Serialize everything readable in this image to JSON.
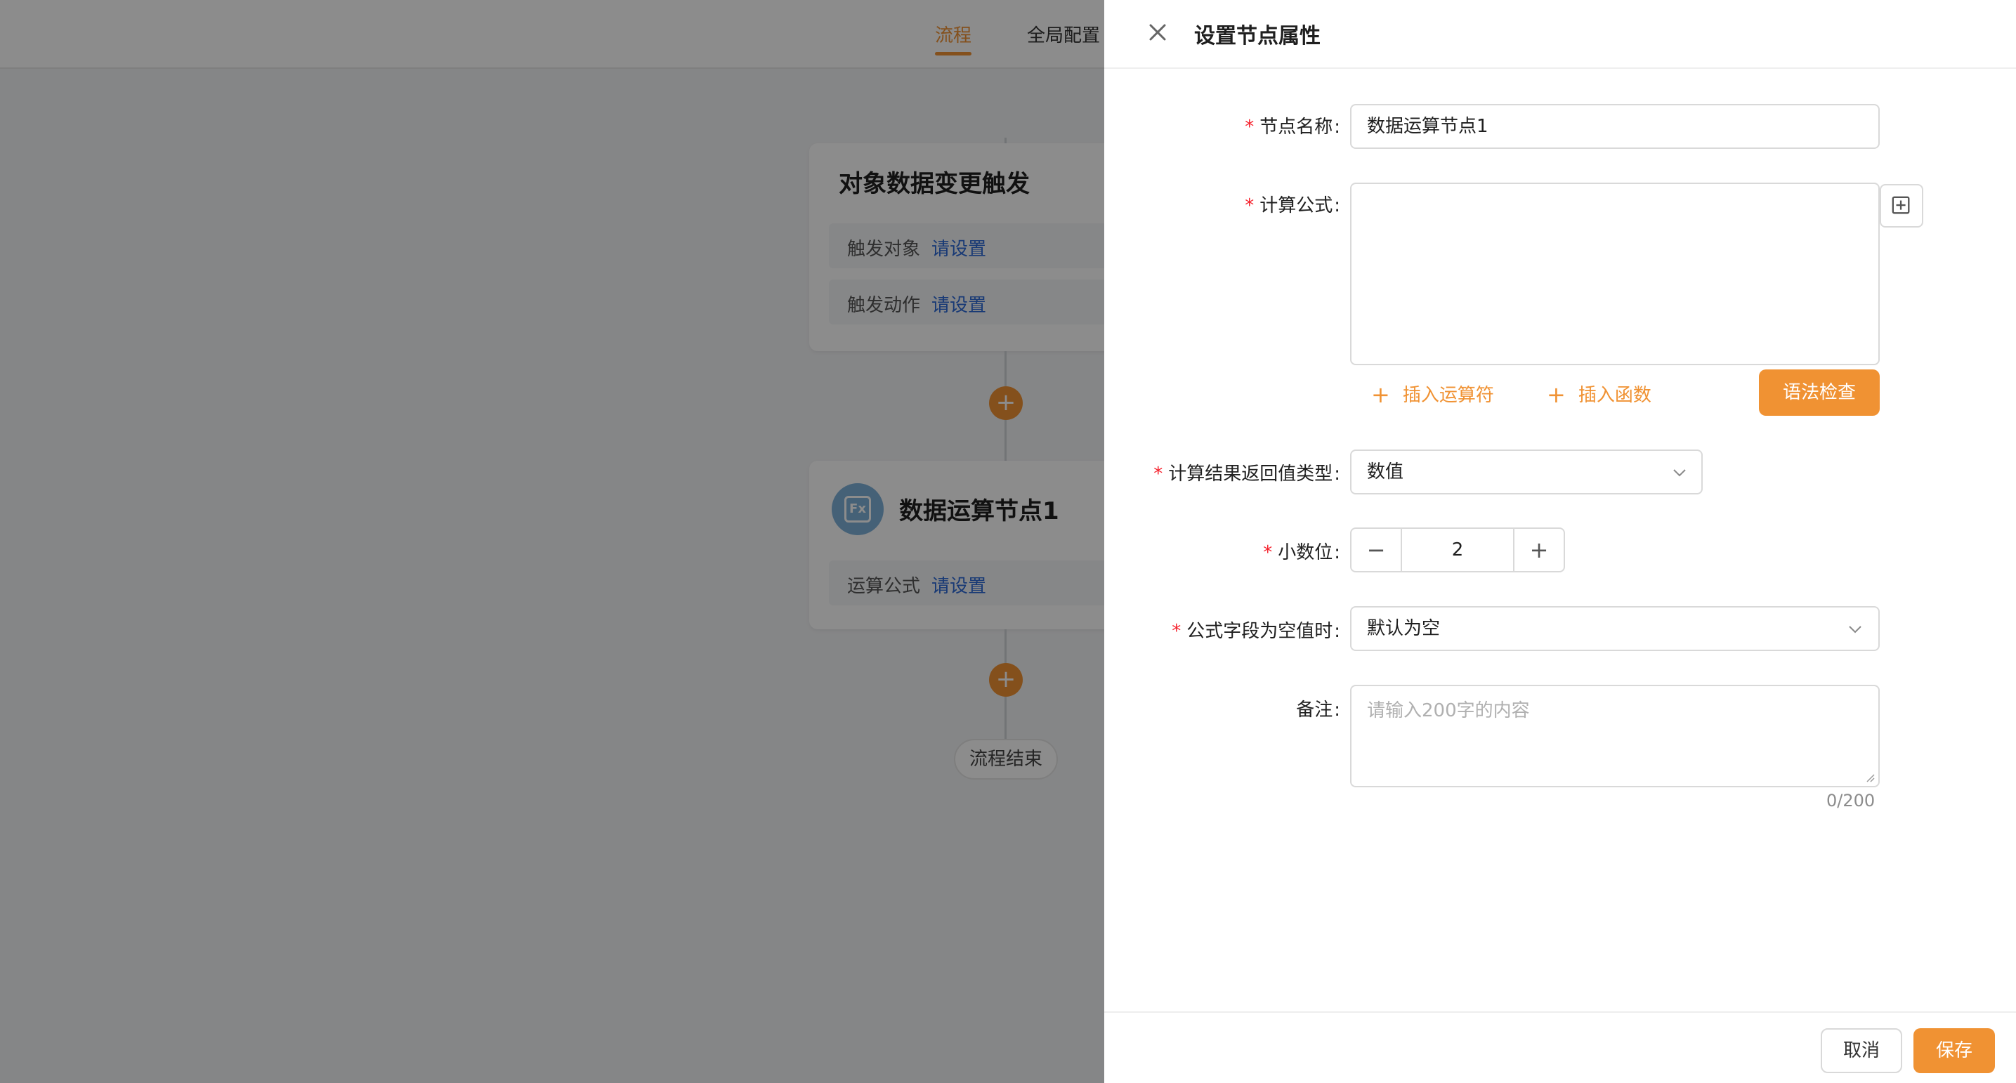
{
  "tabs": {
    "flow": "流程",
    "global_config": "全局配置"
  },
  "canvas": {
    "trigger_card": {
      "title": "对象数据变更触发",
      "rows": [
        {
          "key": "触发对象",
          "value": "请设置"
        },
        {
          "key": "触发动作",
          "value": "请设置"
        }
      ]
    },
    "compute_card": {
      "icon_text": "Fx",
      "title": "数据运算节点1",
      "rows": [
        {
          "key": "运算公式",
          "value": "请设置"
        }
      ]
    },
    "add_label": "+",
    "end_label": "流程结束"
  },
  "drawer": {
    "title": "设置节点属性",
    "required_mark": "*",
    "colon": ":",
    "fields": {
      "node_name": {
        "label": "节点名称",
        "value": "数据运算节点1"
      },
      "formula": {
        "label": "计算公式",
        "value": ""
      },
      "return_type": {
        "label": "计算结果返回值类型",
        "value": "数值"
      },
      "decimals": {
        "label": "小数位",
        "value": "2",
        "minus": "−",
        "plus": "+"
      },
      "empty_value": {
        "label": "公式字段为空值时",
        "value": "默认为空"
      },
      "remark": {
        "label": "备注",
        "placeholder": "请输入200字的内容",
        "counter": "0/200"
      }
    },
    "insert_operator": "插入运算符",
    "insert_function": "插入函数",
    "plus_glyph": "+",
    "syntax_check": "语法检查",
    "cancel": "取消",
    "save": "保存"
  },
  "colors": {
    "accent": "#f09233",
    "link": "#2f6bd6",
    "required": "#f5222d"
  }
}
